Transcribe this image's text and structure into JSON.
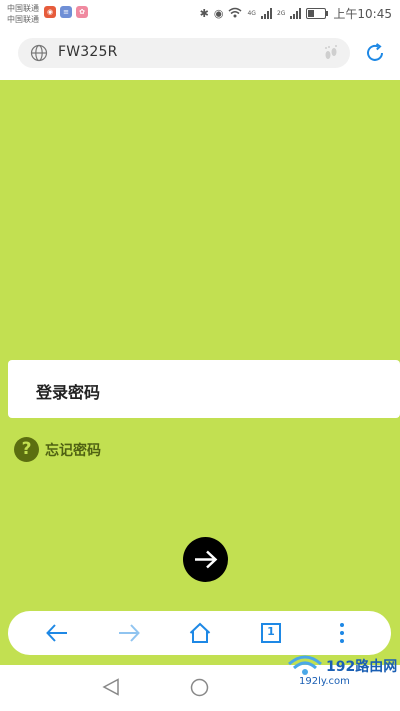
{
  "status_bar": {
    "carrier1": "中国联通",
    "carrier2": "中国联通",
    "time": "上午10:45",
    "battery_level": 0.4,
    "app_icons": [
      "weibo-icon",
      "message-icon",
      "gift-icon"
    ],
    "network1": "4G",
    "network2": "2G"
  },
  "url_bar": {
    "url": "FW325R"
  },
  "page": {
    "background_color": "#c2e051",
    "password_label": "登录密码",
    "forgot_password": "忘记密码"
  },
  "toolbar": {
    "tab_count": "1"
  },
  "watermark": {
    "title": "192路由网",
    "url": "192ly.com"
  }
}
